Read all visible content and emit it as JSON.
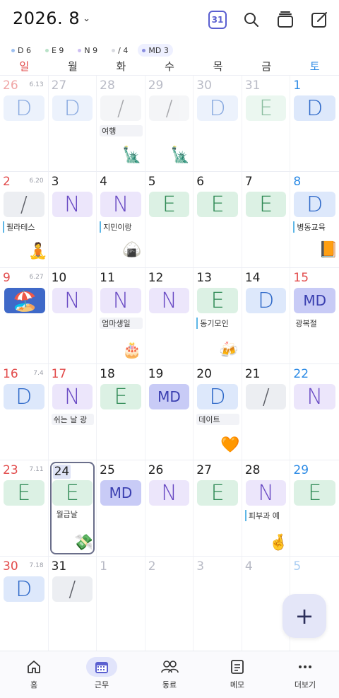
{
  "header": {
    "title": "2026. 8",
    "calendar_badge": "31"
  },
  "counts": [
    {
      "label": "D 6",
      "color": "#9ec0f0"
    },
    {
      "label": "E 9",
      "color": "#b9e2c8"
    },
    {
      "label": "N 9",
      "color": "#cdbff2"
    },
    {
      "label": "/ 4",
      "color": "#d8dae0"
    },
    {
      "label": "MD 3",
      "color": "#8a8ee0"
    }
  ],
  "weekdays": [
    "일",
    "월",
    "화",
    "수",
    "목",
    "금",
    "토"
  ],
  "weeks": [
    {
      "days": [
        {
          "num": "26",
          "lunar": "6.13",
          "shift": "D",
          "faded": true
        },
        {
          "num": "27",
          "shift": "D",
          "faded": true
        },
        {
          "num": "28",
          "shift": "/",
          "faded": true,
          "memo": "여행",
          "memo_style": "bg",
          "emoji": "🗽"
        },
        {
          "num": "29",
          "shift": "/",
          "faded": true,
          "emoji": "🗽"
        },
        {
          "num": "30",
          "shift": "D",
          "faded": true
        },
        {
          "num": "31",
          "shift": "E",
          "faded": true
        },
        {
          "num": "1",
          "shift": "D"
        }
      ]
    },
    {
      "days": [
        {
          "num": "2",
          "lunar": "6.20",
          "shift": "/",
          "memo": "필라테스",
          "memo_style": "bar",
          "emoji": "🧘"
        },
        {
          "num": "3",
          "shift": "N"
        },
        {
          "num": "4",
          "shift": "N",
          "memo": "지민이랑",
          "memo_style": "bar",
          "emoji": "🍙"
        },
        {
          "num": "5",
          "shift": "E"
        },
        {
          "num": "6",
          "shift": "E"
        },
        {
          "num": "7",
          "shift": "E"
        },
        {
          "num": "8",
          "shift": "D",
          "memo": "병동교육",
          "memo_style": "bar",
          "emoji": "📙"
        }
      ]
    },
    {
      "days": [
        {
          "num": "9",
          "lunar": "6.27",
          "emoji": "🏖️",
          "big": true
        },
        {
          "num": "10",
          "shift": "N"
        },
        {
          "num": "11",
          "shift": "N",
          "memo": "엄마생일",
          "memo_style": "bg",
          "emoji": "🎂"
        },
        {
          "num": "12",
          "shift": "N"
        },
        {
          "num": "13",
          "shift": "E",
          "memo": "동기모인",
          "memo_style": "bar",
          "emoji": "🍻"
        },
        {
          "num": "14",
          "shift": "D"
        },
        {
          "num": "15",
          "shift": "MD",
          "memo": "광복절",
          "memo_style": "none",
          "holiday": true
        }
      ]
    },
    {
      "days": [
        {
          "num": "16",
          "lunar": "7.4",
          "shift": "D"
        },
        {
          "num": "17",
          "shift": "N",
          "memo": "쉬는 날 광",
          "memo_style": "bg",
          "red": true
        },
        {
          "num": "18",
          "shift": "E"
        },
        {
          "num": "19",
          "shift": "MD"
        },
        {
          "num": "20",
          "shift": "D",
          "memo": "데이트",
          "memo_style": "bg",
          "emoji": "🧡"
        },
        {
          "num": "21",
          "shift": "/"
        },
        {
          "num": "22",
          "shift": "N"
        }
      ]
    },
    {
      "days": [
        {
          "num": "23",
          "lunar": "7.11",
          "shift": "E"
        },
        {
          "num": "24",
          "shift": "E",
          "memo": "월급날",
          "memo_style": "none",
          "emoji": "💸",
          "today": true
        },
        {
          "num": "25",
          "shift": "MD"
        },
        {
          "num": "26",
          "shift": "N"
        },
        {
          "num": "27",
          "shift": "E"
        },
        {
          "num": "28",
          "shift": "N",
          "memo": "피부과 예",
          "memo_style": "bar",
          "emoji": "🤞"
        },
        {
          "num": "29",
          "shift": "E"
        }
      ]
    },
    {
      "days": [
        {
          "num": "30",
          "lunar": "7.18",
          "shift": "D"
        },
        {
          "num": "31",
          "shift": "/"
        },
        {
          "num": "1",
          "next": true
        },
        {
          "num": "2",
          "next": true
        },
        {
          "num": "3",
          "next": true
        },
        {
          "num": "4",
          "next": true
        },
        {
          "num": "5",
          "next": true
        }
      ]
    }
  ],
  "fab_label": "+",
  "nav": [
    {
      "label": "홈",
      "icon": "home-icon"
    },
    {
      "label": "근무",
      "icon": "calendar-icon",
      "active": true
    },
    {
      "label": "동료",
      "icon": "people-icon"
    },
    {
      "label": "메모",
      "icon": "memo-icon"
    },
    {
      "label": "더보기",
      "icon": "more-icon"
    }
  ]
}
